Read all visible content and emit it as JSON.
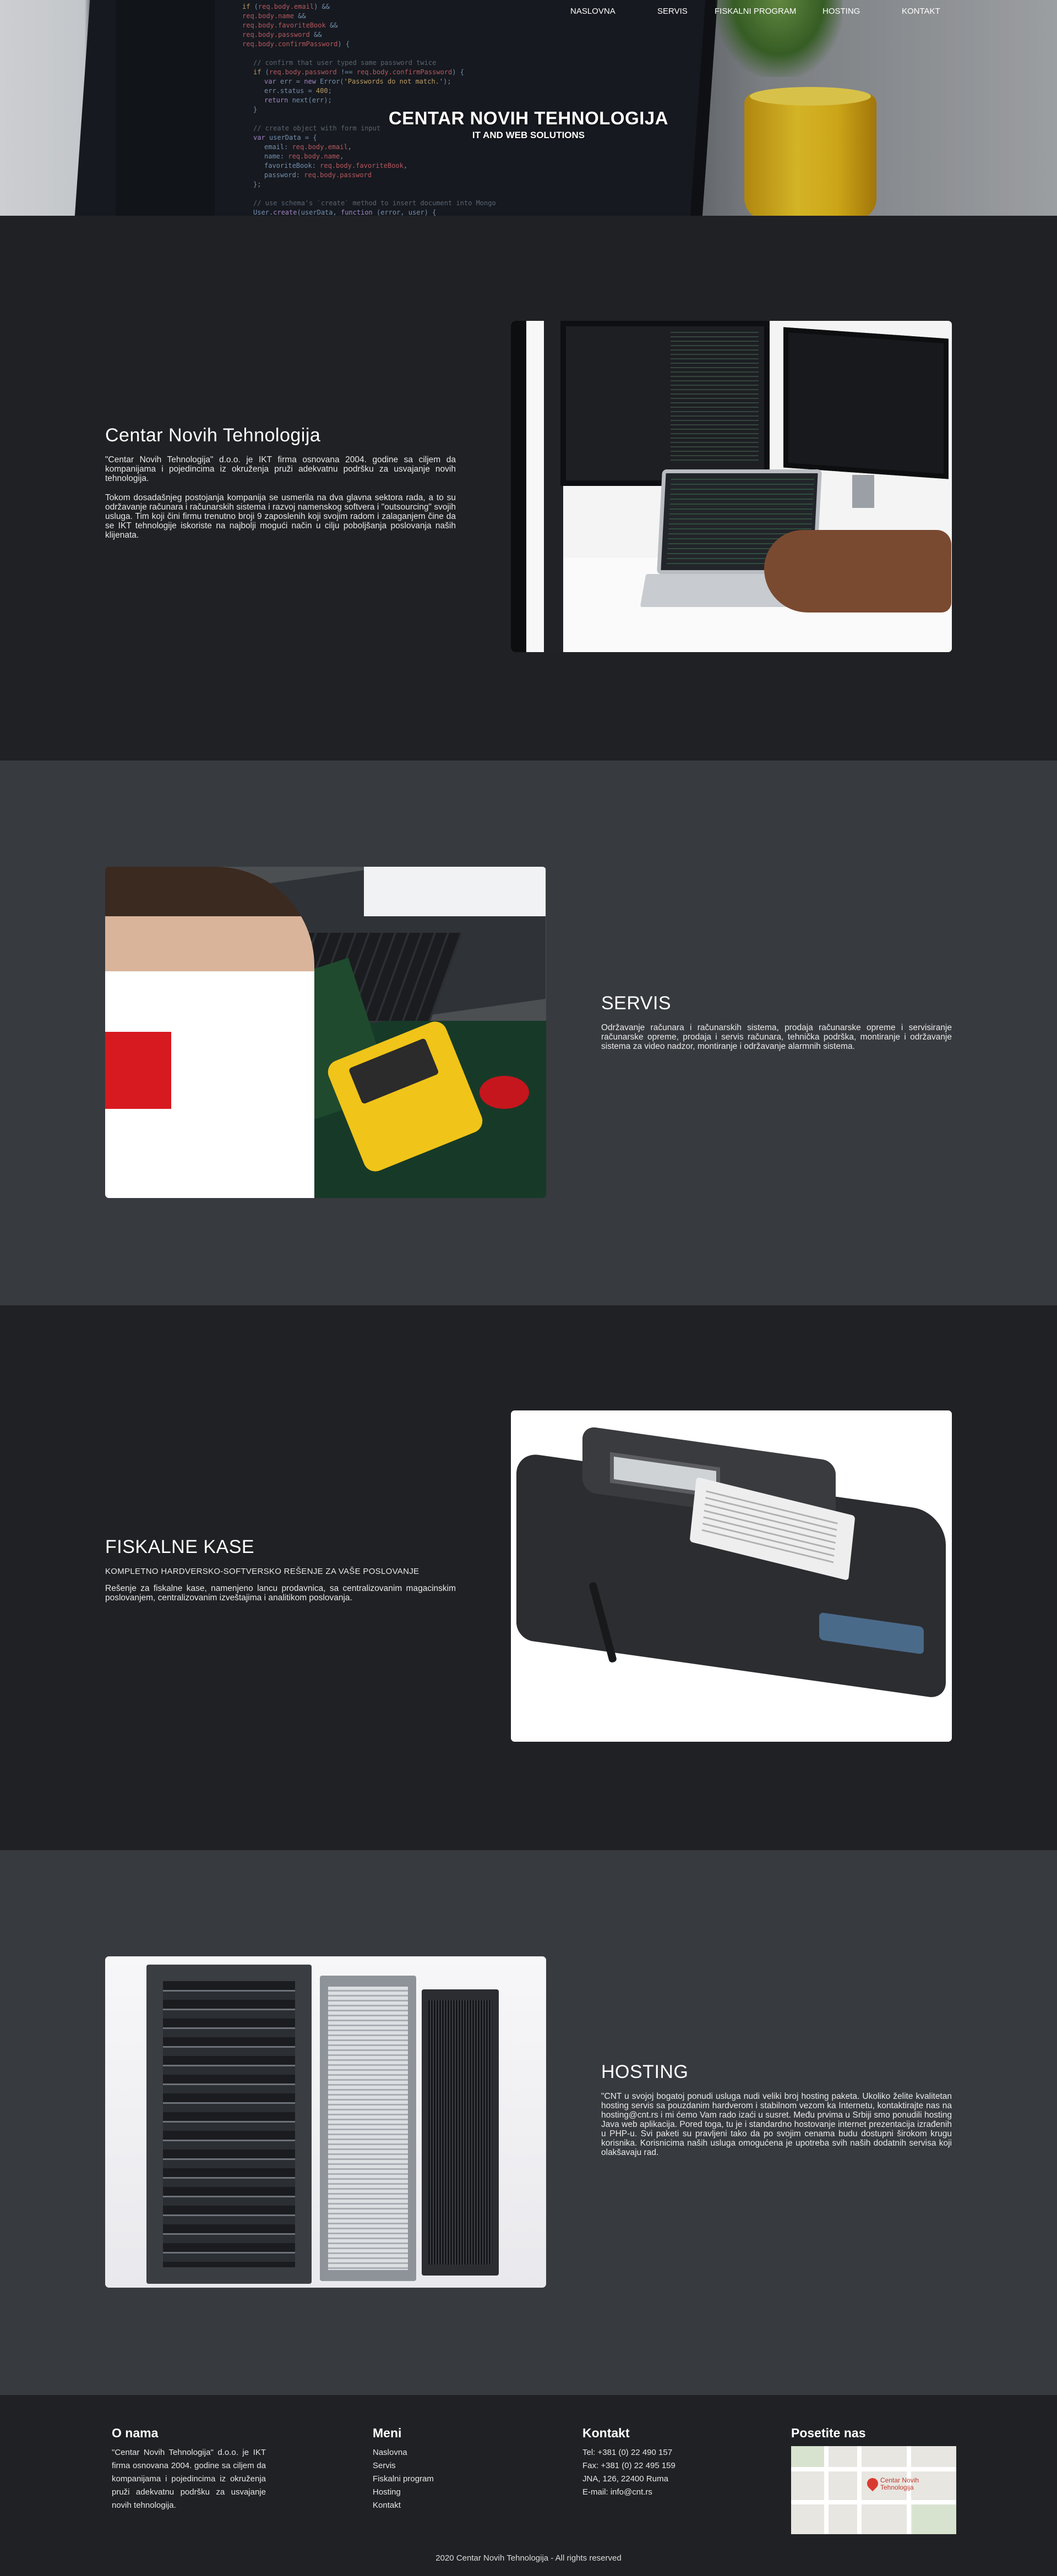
{
  "nav": {
    "items": [
      "NASLOVNA",
      "SERVIS",
      "FISKALNI PROGRAM",
      "HOSTING",
      "KONTAKT"
    ]
  },
  "hero": {
    "title": "CENTAR NOVIH TEHNOLOGIJA",
    "subtitle": "IT AND WEB SOLUTIONS"
  },
  "about": {
    "title": "Centar Novih Tehnologija",
    "p1": "\"Centar Novih Tehnologija\" d.o.o. je IKT firma osnovana 2004. godine sa ciljem da kompanijama i pojedincima iz okruženja pruži adekvatnu podršku za usvajanje novih tehnologija.",
    "p2": "Tokom dosadašnjeg postojanja kompanija se usmerila na dva glavna sektora rada, a to su održavanje računara i računarskih sistema i razvoj namenskog softvera i \"outsourcing\" svojih usluga. Tim koji čini firmu trenutno broji 9 zaposlenih koji svojim radom i zalaganjem čine da se IKT tehnologije iskoriste na najbolji mogući način u cilju poboljšanja poslovanja naših klijenata."
  },
  "servis": {
    "title": "SERVIS",
    "p1": "Održavanje računara i računarskih sistema, prodaja računarske opreme i servisiranje računarske opreme, prodaja i servis računara, tehnička podrška, montiranje i održavanje sistema za video nadzor, montiranje i održavanje alarmnih sistema."
  },
  "fiskalne": {
    "title": "FISKALNE KASE",
    "subtitle": "KOMPLETNO HARDVERSKO-SOFTVERSKO REŠENJE ZA VAŠE POSLOVANJE",
    "p1": "Rešenje za fiskalne kase, namenjeno lancu prodavnica, sa centralizovanim magacinskim poslovanjem, centralizovanim izveštajima i analitikom poslovanja."
  },
  "hosting": {
    "title": "HOSTING",
    "p1": "\"CNT u svojoj bogatoj ponudi usluga nudi veliki broj hosting paketa. Ukoliko želite kvalitetan hosting servis sa pouzdanim hardverom i stabilnom vezom ka Internetu, kontaktirajte nas na hosting@cnt.rs i mi ćemo Vam rado izaći u susret. Među prvima u Srbiji smo ponudili hosting Java web aplikacija. Pored toga, tu je i standardno hostovanje internet prezentacija izrađenih u PHP-u. Svi paketi su pravljeni tako da po svojim cenama budu dostupni širokom krugu korisnika. Korisnicima naših usluga omogućena je upotreba svih naših dodatnih servisa koji olakšavaju rad."
  },
  "footer": {
    "about_title": "O nama",
    "about_text": "\"Centar Novih Tehnologija\" d.o.o. je IKT firma osnovana 2004. godine sa ciljem da kompanijama i pojedincima iz okruženja pruži adekvatnu podršku za usvajanje novih tehnologija.",
    "menu_title": "Meni",
    "menu_items": [
      "Naslovna",
      "Servis",
      "Fiskalni program",
      "Hosting",
      "Kontakt"
    ],
    "contact_title": "Kontakt",
    "contact": {
      "tel": "Tel: +381 (0) 22 490 157",
      "fax": "Fax: +381 (0) 22 495 159",
      "address": "JNA, 126, 22400 Ruma",
      "email": "E-mail: info@cnt.rs"
    },
    "visit_title": "Posetite nas",
    "map_label_1": "Centar Novih",
    "map_label_2": "Tehnologija",
    "copyright": "2020 Centar Novih Tehnologija - All rights reserved"
  }
}
